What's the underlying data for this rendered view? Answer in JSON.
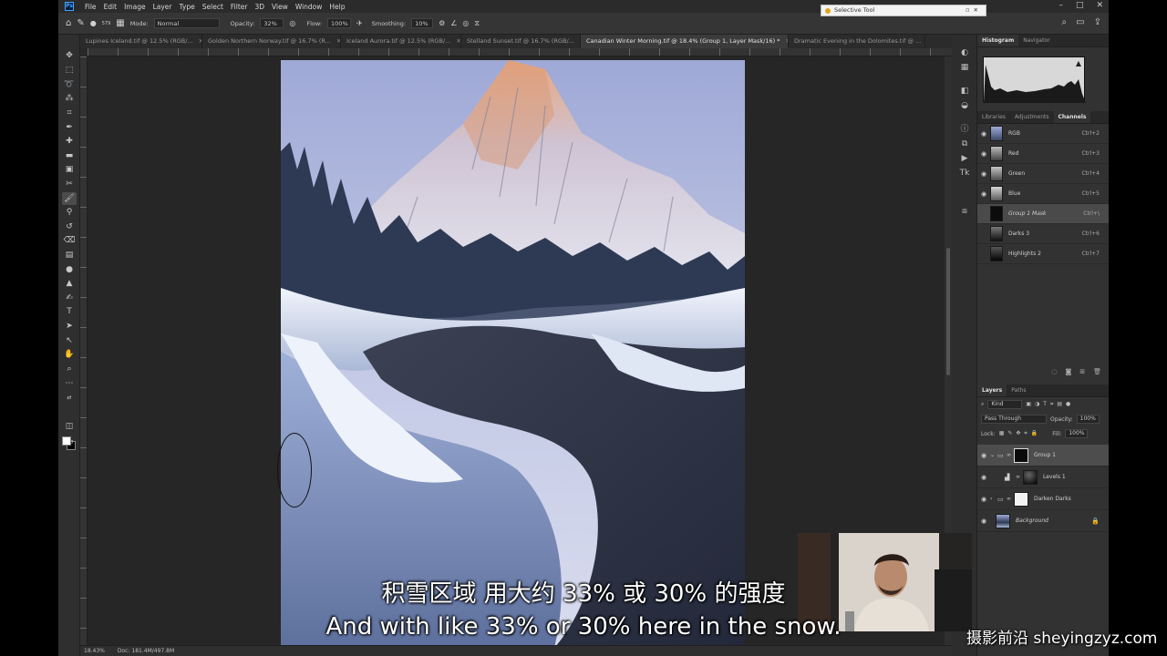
{
  "menu": {
    "logo": "Ps",
    "items": [
      "File",
      "Edit",
      "Image",
      "Layer",
      "Type",
      "Select",
      "Filter",
      "3D",
      "View",
      "Window",
      "Help"
    ]
  },
  "options": {
    "brush_size": "579",
    "mode_label": "Mode:",
    "mode_value": "Normal",
    "opacity_label": "Opacity:",
    "opacity_value": "32%",
    "flow_label": "Flow:",
    "flow_value": "100%",
    "smoothing_label": "Smoothing:",
    "smoothing_value": "10%"
  },
  "selective_tool": {
    "title": "Selective Tool"
  },
  "tabs": [
    {
      "label": "Lupines Iceland.tif @ 12.5% (RGB/..."
    },
    {
      "label": "Golden Northern Norway.tif @ 16.7% (R..."
    },
    {
      "label": "Iceland Aurora.tif @ 12.5% (RGB/..."
    },
    {
      "label": "Stelland Sunset.tif @ 16.7% (RGB/..."
    },
    {
      "label": "Canadian Winter Morning.tif @ 18.4% (Group 1, Layer Mask/16) *"
    },
    {
      "label": "Dramatic Evening in the Dolomites.tif @ ..."
    }
  ],
  "status": {
    "zoom": "18.43%",
    "doc": "Doc: 181.4M/497.8M"
  },
  "histogram_panel": {
    "tabs": [
      "Histogram",
      "Navigator"
    ]
  },
  "channels_panel": {
    "tabs": [
      "Libraries",
      "Adjustments",
      "Channels"
    ],
    "rows": [
      {
        "name": "RGB",
        "shortcut": "Ctrl+2"
      },
      {
        "name": "Red",
        "shortcut": "Ctrl+3"
      },
      {
        "name": "Green",
        "shortcut": "Ctrl+4"
      },
      {
        "name": "Blue",
        "shortcut": "Ctrl+5"
      },
      {
        "name": "Group 1 Mask",
        "shortcut": "Ctrl+\\"
      },
      {
        "name": "Darks 3",
        "shortcut": "Ctrl+6"
      },
      {
        "name": "Highlights 2",
        "shortcut": "Ctrl+7"
      }
    ]
  },
  "layers_panel": {
    "tabs": [
      "Layers",
      "Paths"
    ],
    "kind": "Kind",
    "blend_mode": "Pass Through",
    "opacity_label": "Opacity:",
    "opacity_value": "100%",
    "lock_label": "Lock:",
    "fill_label": "Fill:",
    "fill_value": "100%",
    "layers": [
      {
        "name": "Group 1"
      },
      {
        "name": "Levels 1"
      },
      {
        "name": "Darken Darks"
      },
      {
        "name": "Background"
      }
    ]
  },
  "subtitles": {
    "chinese": "积雪区域 用大约 33% 或 30% 的强度",
    "english": "And with like 33% or 30% here in the snow."
  },
  "watermark": "摄影前沿 sheyingzyz.com"
}
